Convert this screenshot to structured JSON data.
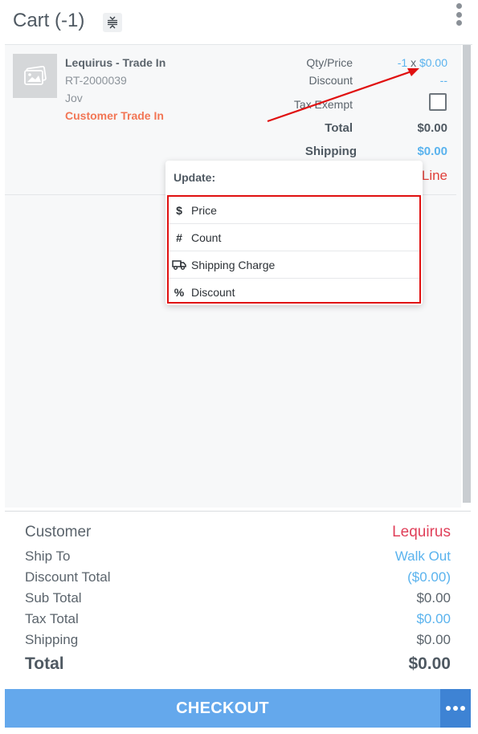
{
  "header": {
    "title": "Cart (-1)",
    "collapse_icon": "collapse-vertical-icon",
    "menu_icon": "kebab-menu-icon"
  },
  "item": {
    "name": "Lequirus - Trade In",
    "sku": "RT-2000039",
    "owner": "Jov",
    "type": "Customer Trade In",
    "qty_price_label": "Qty/Price",
    "qty": "-1",
    "times": "x",
    "price": "$0.00",
    "discount_label": "Discount",
    "discount_value": "--",
    "tax_exempt_label": "Tax Exempt",
    "total_label": "Total",
    "total_value": "$0.00",
    "shipping_label": "Shipping",
    "shipping_value": "$0.00",
    "line_link": "Line"
  },
  "popup": {
    "title": "Update:",
    "options": [
      {
        "label": "Price",
        "icon": "dollar-icon"
      },
      {
        "label": "Count",
        "icon": "hash-icon"
      },
      {
        "label": "Shipping Charge",
        "icon": "truck-icon"
      },
      {
        "label": "Discount",
        "icon": "percent-icon"
      }
    ]
  },
  "summary": {
    "customer_label": "Customer",
    "customer_value": "Lequirus",
    "ship_to_label": "Ship To",
    "ship_to_value": "Walk Out",
    "discount_total_label": "Discount Total",
    "discount_total_value": "($0.00)",
    "sub_total_label": "Sub Total",
    "sub_total_value": "$0.00",
    "tax_total_label": "Tax Total",
    "tax_total_value": "$0.00",
    "shipping_label": "Shipping",
    "shipping_value": "$0.00",
    "total_label": "Total",
    "total_value": "$0.00"
  },
  "footer": {
    "checkout_label": "CHECKOUT",
    "more_icon": "more-horizontal-icon"
  },
  "colors": {
    "accent_blue": "#5ab3ee",
    "checkout_blue": "#64a8ec",
    "more_blue": "#3e83d4",
    "trade_in_orange": "#f27655",
    "customer_red": "#e0405a",
    "annotation_red": "#e01010"
  }
}
